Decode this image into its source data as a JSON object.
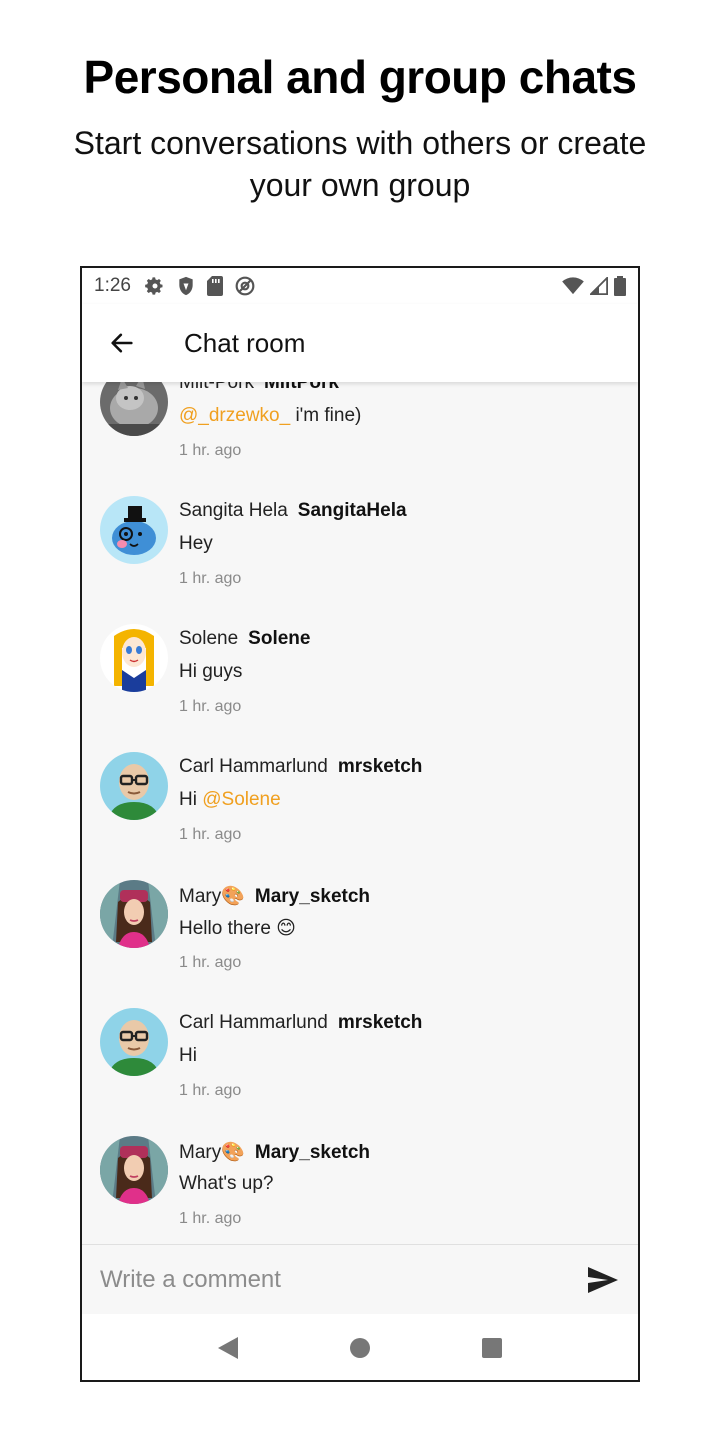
{
  "promo": {
    "title": "Personal and group chats",
    "subtitle": "Start conversations with others or create your own group"
  },
  "status_bar": {
    "time": "1:26",
    "left_icons": [
      "settings-icon",
      "shield-icon",
      "sd-card-icon",
      "at-sign-icon"
    ],
    "right_icons": [
      "wifi-icon",
      "signal-icon",
      "battery-icon"
    ]
  },
  "app_bar": {
    "title": "Chat room",
    "back_icon": "arrow-left-icon"
  },
  "messages": [
    {
      "display_name": "Milt-Pork",
      "username": "MiltPork",
      "mention": "@_drzewko_",
      "text": " i'm fine)",
      "time": "1 hr. ago",
      "avatar": "cat-photo"
    },
    {
      "display_name": "Sangita Hela",
      "username": "SangitaHela",
      "mention": "",
      "text": "Hey",
      "time": "1 hr. ago",
      "avatar": "blue-blob-top-hat"
    },
    {
      "display_name": "Solene",
      "username": "Solene",
      "mention": "",
      "text": "Hi guys",
      "time": "1 hr. ago",
      "avatar": "cartoon-girl"
    },
    {
      "display_name": "Carl Hammarlund",
      "username": "mrsketch",
      "mention_prefix": "Hi ",
      "mention": "@Solene",
      "text": "",
      "time": "1 hr. ago",
      "avatar": "bald-man-glasses"
    },
    {
      "display_name": "Mary🎨",
      "username": "Mary_sketch",
      "mention": "",
      "text": "Hello there 😊",
      "time": "1 hr. ago",
      "avatar": "woman-pink-hat"
    },
    {
      "display_name": "Carl Hammarlund",
      "username": "mrsketch",
      "mention": "",
      "text": "Hi",
      "time": "1 hr. ago",
      "avatar": "bald-man-glasses"
    },
    {
      "display_name": "Mary🎨",
      "username": "Mary_sketch",
      "mention": "",
      "text": "What's up?",
      "time": "1 hr. ago",
      "avatar": "woman-pink-hat"
    }
  ],
  "composer": {
    "placeholder": "Write a comment",
    "send_icon": "send-icon"
  },
  "nav_bar": {
    "buttons": [
      "back-triangle-icon",
      "home-circle-icon",
      "recents-square-icon"
    ]
  },
  "colors": {
    "mention": "#f0a020",
    "background": "#f7f7f7",
    "timestamp": "#8a8a8a"
  }
}
